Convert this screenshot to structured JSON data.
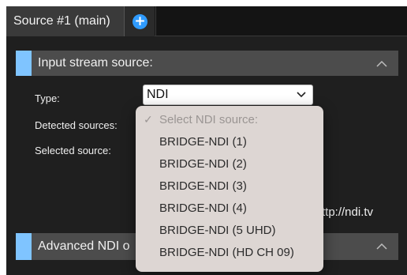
{
  "tabs": {
    "active_label": "Source #1 (main)",
    "add_icon": "plus-circle-icon"
  },
  "input_section": {
    "title": "Input stream source:",
    "type_label": "Type:",
    "detected_label": "Detected sources:",
    "selected_label": "Selected source:",
    "type_value": "NDI",
    "ndi_link_text": "ttp://ndi.tv"
  },
  "dropdown": {
    "placeholder": "Select NDI source:",
    "options": [
      "BRIDGE-NDI (1)",
      "BRIDGE-NDI (2)",
      "BRIDGE-NDI (3)",
      "BRIDGE-NDI (4)",
      "BRIDGE-NDI (5 UHD)",
      "BRIDGE-NDI (HD CH 09)"
    ]
  },
  "advanced_section": {
    "title": "Advanced NDI o"
  },
  "colors": {
    "accent": "#7fc4ff",
    "add_button": "#2f9bff",
    "panel": "#1f1f1f",
    "header": "#4c4c4c"
  }
}
